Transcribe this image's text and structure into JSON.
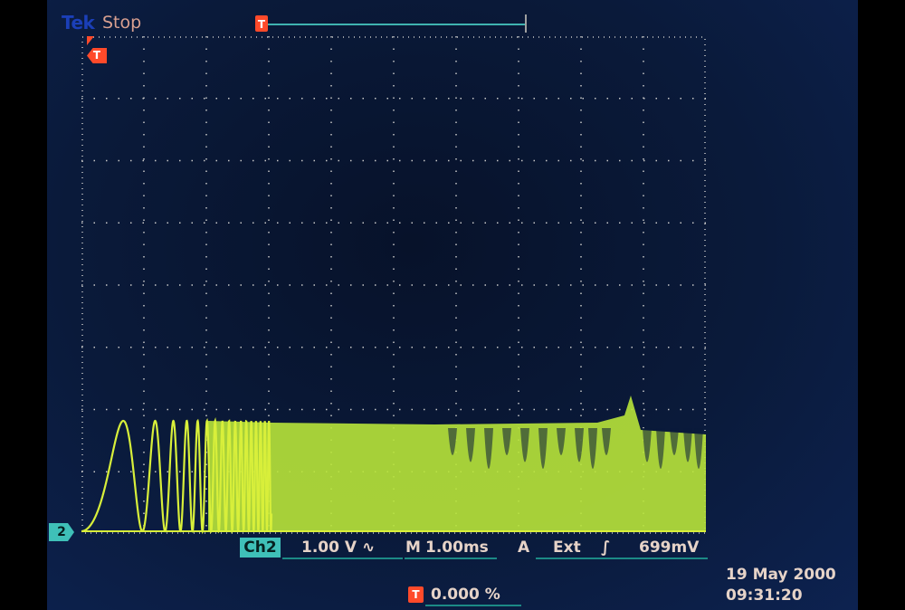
{
  "header": {
    "brand": "Tek",
    "status": "Stop"
  },
  "markers": {
    "trigger_position": "T",
    "trigger_level": "T",
    "channel": "2"
  },
  "readout": {
    "channel": "Ch2",
    "volts_per_div": "1.00 V",
    "coupling_icon": "∿",
    "timebase_prefix": "M",
    "timebase": "1.00ms",
    "trigger_mode": "A",
    "trigger_source": "Ext",
    "trigger_slope_icon": "∫",
    "trigger_level": "699mV",
    "position_icon": "T",
    "position": "0.000 %",
    "date": "19 May 2000",
    "time": "09:31:20"
  },
  "colors": {
    "trace": "#d8ef3a",
    "trace_dense": "#b8e43a",
    "graticule": "#c8c8c8",
    "marker": "#ff4a2a",
    "channel_box": "#3fc0b8",
    "readout_text": "#e6d3c8"
  }
}
